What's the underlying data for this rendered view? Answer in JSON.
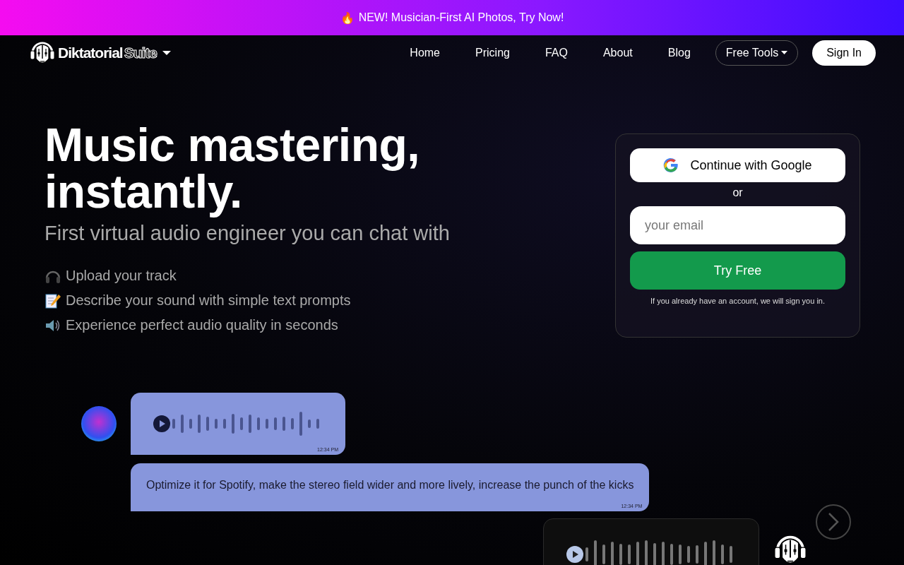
{
  "banner": {
    "icon": "🔥",
    "text": "NEW! Musician-First AI Photos, Try Now!"
  },
  "nav": {
    "brand": [
      "Diktatorial",
      "Suite"
    ],
    "links": [
      {
        "label": "Home",
        "kind": "link"
      },
      {
        "label": "Pricing",
        "kind": "link"
      },
      {
        "label": "FAQ",
        "kind": "link"
      },
      {
        "label": "About",
        "kind": "link"
      },
      {
        "label": "Blog",
        "kind": "link"
      },
      {
        "label": "Free Tools",
        "kind": "dropdown"
      },
      {
        "label": "Sign In",
        "kind": "primary"
      }
    ]
  },
  "hero": {
    "title": "Music mastering, instantly.",
    "subtitle": "First virtual audio engineer you can chat with",
    "features": [
      {
        "kind": "headphones",
        "text": "Upload your track"
      },
      {
        "kind": "memo",
        "text": "Describe your sound with simple text prompts"
      },
      {
        "kind": "speaker",
        "text": "Experience perfect audio quality in seconds"
      }
    ]
  },
  "signup": {
    "google_button": "Continue with Google",
    "separator": "or",
    "email": {
      "placeholder": "your email"
    },
    "submit": "Try Free",
    "note": "If you already have an account, we will sign you in."
  },
  "chat": {
    "messages": [
      {
        "kind": "user_audio",
        "time": "12:34 PM"
      },
      {
        "kind": "text",
        "text": "Optimize it for Spotify, make the stereo field wider and more lively, increase the punch of the kicks",
        "time": "12:34 PM"
      },
      {
        "kind": "bot_audio"
      }
    ]
  }
}
